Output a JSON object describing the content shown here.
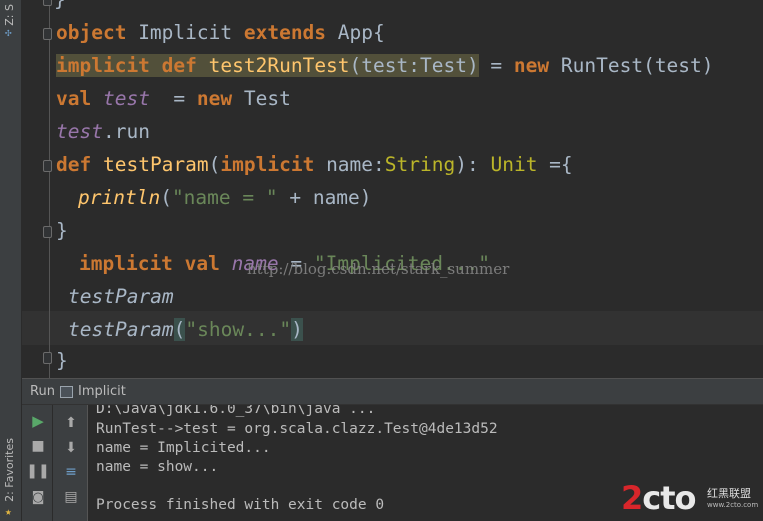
{
  "tool_strip": {
    "top_label": "Z: S",
    "bottom_label": "2: Favorites"
  },
  "editor": {
    "line1": {
      "kw1": "object",
      "name": " Implicit ",
      "kw2": "extends",
      "rest": " App{"
    },
    "line2": {
      "kw1": "implicit",
      "kw2": "def",
      "fn": "test2RunTest",
      "params": "(test:Test)",
      "eq": " = ",
      "kw3": "new",
      "rest": " RunTest(test)"
    },
    "line3": {
      "kw1": "val",
      "var": "test",
      "eq": "  = ",
      "kw2": "new",
      "rest": " Test"
    },
    "line4": {
      "var": "test",
      "rest": ".run"
    },
    "line5": {
      "kw1": "def",
      "fn": "testParam",
      "open": "(",
      "kw2": "implicit",
      "param": " name:",
      "type": "String",
      "close": "): ",
      "ret": "Unit",
      "rest": " ={"
    },
    "line6": {
      "fn": "println",
      "open": "(",
      "str": "\"name = \"",
      "rest": " + name)"
    },
    "line7": {
      "text": "}"
    },
    "line8": {
      "kw1": "implicit",
      "kw2": "val",
      "var": "name",
      "eq": " = ",
      "str": "\"Implicited...\""
    },
    "line9": {
      "call": "testParam"
    },
    "line10": {
      "call": "testParam",
      "open": "(",
      "str": "\"show...\"",
      "close": ")"
    },
    "line11": {
      "text": "}"
    },
    "watermark": "http://blog.csdn.net/stark_summer"
  },
  "run_panel": {
    "label": "Run",
    "config_name": "Implicit",
    "console_lines": [
      "D:\\Java\\jdk1.6.0_37\\bin\\java ...",
      "RunTest-->test = org.scala.clazz.Test@4de13d52",
      "name = Implicited...",
      "name = show...",
      "",
      "Process finished with exit code 0"
    ]
  },
  "logo": {
    "part1": "2",
    "part2": "cto",
    "suffix": ".com",
    "sub": "红黑联盟",
    "sub2": "www.2cto.com"
  },
  "colors": {
    "keyword": "#cc7832",
    "string": "#6a8759",
    "field": "#9876aa",
    "function": "#ffc66d",
    "type": "#bbb529",
    "run_green": "#59a869"
  }
}
